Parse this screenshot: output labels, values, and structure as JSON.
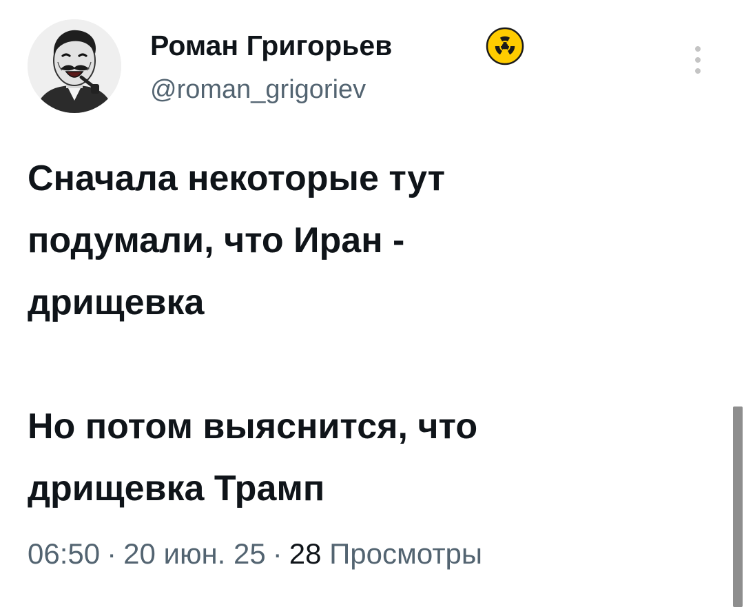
{
  "author": {
    "display_name": "Роман Григорьев",
    "handle": "@roman_grigoriev",
    "badge_icon": "radioactive-icon",
    "avatar_icon": "laughing-man-avatar"
  },
  "tweet": {
    "paragraphs": [
      "Сначала некоторые тут\nподумали, что Иран -\nдрищевка",
      "Но потом выяснится, что\nдрищевка Трамп"
    ]
  },
  "meta": {
    "time": "06:50",
    "separator": "·",
    "date": "20 июн. 25",
    "views_count": "28",
    "views_label": "Просмотры"
  },
  "colors": {
    "text_primary": "#0f1419",
    "text_secondary": "#536471",
    "badge_yellow": "#ffcc00",
    "background": "#ffffff"
  }
}
